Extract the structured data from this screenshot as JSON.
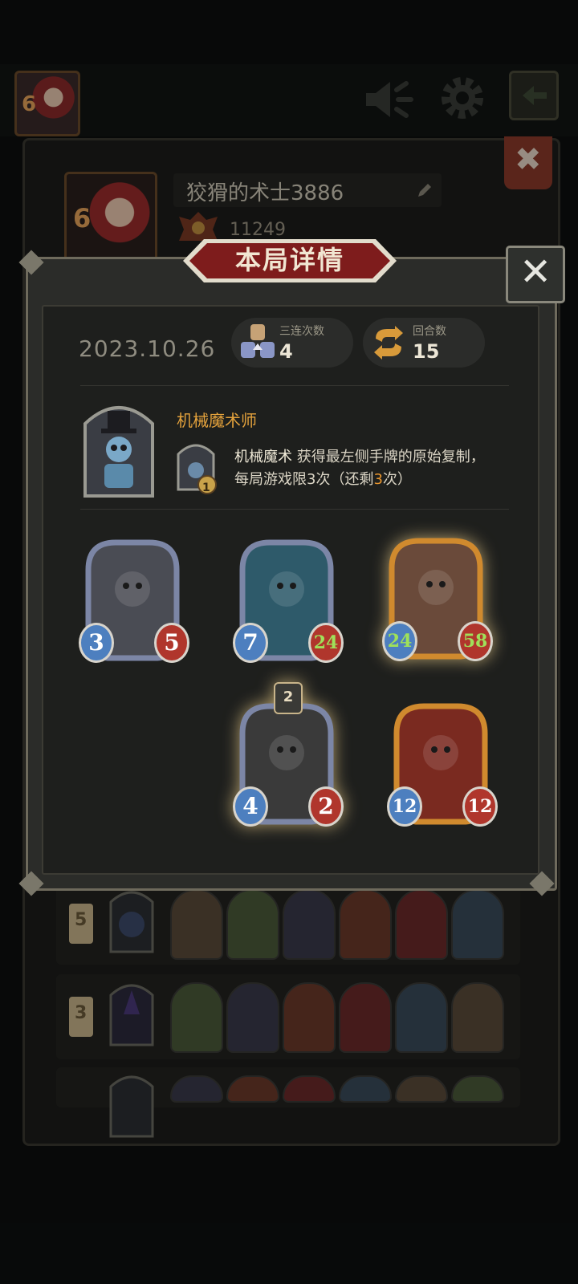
{
  "top_bar": {
    "player_level": "6",
    "icons": [
      "speaker-icon",
      "gear-icon",
      "back-arrow-icon"
    ]
  },
  "profile": {
    "level": "6",
    "name": "狡猾的术士3886",
    "score": "11249"
  },
  "modal": {
    "title": "本局详情",
    "date": "2023.10.26",
    "triples_label": "三连次数",
    "triples_value": "4",
    "rounds_label": "回合数",
    "rounds_value": "15",
    "hero": {
      "name": "机械魔术师",
      "skill_level": "1",
      "skill_name": "机械魔术",
      "skill_desc_1": " 获得最左侧手牌的原始复制，",
      "skill_desc_2": "每局游戏限3次（还剩",
      "skill_remaining": "3",
      "skill_desc_3": "次）"
    },
    "cards": [
      {
        "name": "dragon-card",
        "attack": "3",
        "health": "5",
        "tier": ""
      },
      {
        "name": "demon-card",
        "attack": "7",
        "health": "24",
        "tier": ""
      },
      {
        "name": "brute-card",
        "attack": "24",
        "health": "58",
        "tier": ""
      },
      {
        "name": "knight-card",
        "attack": "4",
        "health": "2",
        "tier": "2"
      },
      {
        "name": "demon-lord-card",
        "attack": "12",
        "health": "12",
        "tier": ""
      }
    ]
  },
  "history": [
    {
      "rank": "5",
      "minions": 6
    },
    {
      "rank": "3",
      "minions": 6
    },
    {
      "rank": "",
      "minions": 6
    }
  ],
  "colors": {
    "attack_blue": "#4d7fbf",
    "health_red": "#b0362c",
    "buffed_green": "#9fe05a",
    "gold_frame": "#d08a2e",
    "silver_frame": "#7c86a6",
    "hero_name": "#e4a23c"
  }
}
